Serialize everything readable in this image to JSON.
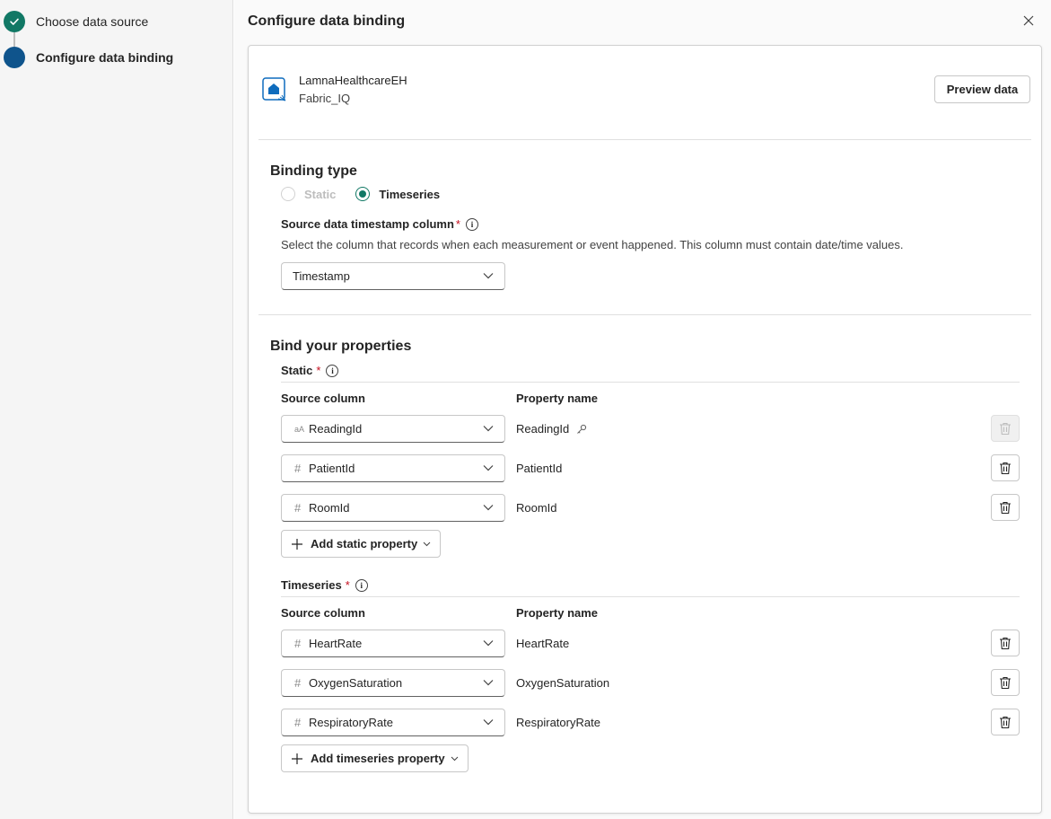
{
  "stepper": {
    "steps": [
      {
        "label": "Choose data source",
        "state": "done"
      },
      {
        "label": "Configure data binding",
        "state": "current"
      }
    ]
  },
  "panel": {
    "title": "Configure data binding",
    "close_icon": "close-icon"
  },
  "source": {
    "name": "LamnaHealthcareEH",
    "workspace": "Fabric_IQ",
    "preview_label": "Preview data"
  },
  "binding_type": {
    "title": "Binding type",
    "options": [
      {
        "label": "Static",
        "selected": false,
        "disabled": true
      },
      {
        "label": "Timeseries",
        "selected": true,
        "disabled": false
      }
    ],
    "timestamp_label": "Source data timestamp column",
    "timestamp_required": "*",
    "timestamp_hint": "Select the column that records when each measurement or event happened. This column must contain date/time values.",
    "timestamp_value": "Timestamp"
  },
  "bind_properties": {
    "title": "Bind your properties",
    "static": {
      "title": "Static",
      "required": "*",
      "source_header": "Source column",
      "property_header": "Property name",
      "rows": [
        {
          "type_icon": "aA",
          "source": "ReadingId",
          "property": "ReadingId",
          "is_key": true,
          "delete_disabled": true
        },
        {
          "type_icon": "#",
          "source": "PatientId",
          "property": "PatientId",
          "is_key": false,
          "delete_disabled": false
        },
        {
          "type_icon": "#",
          "source": "RoomId",
          "property": "RoomId",
          "is_key": false,
          "delete_disabled": false
        }
      ],
      "add_label": "Add static property"
    },
    "timeseries": {
      "title": "Timeseries",
      "required": "*",
      "source_header": "Source column",
      "property_header": "Property name",
      "rows": [
        {
          "type_icon": "#",
          "source": "HeartRate",
          "property": "HeartRate"
        },
        {
          "type_icon": "#",
          "source": "OxygenSaturation",
          "property": "OxygenSaturation"
        },
        {
          "type_icon": "#",
          "source": "RespiratoryRate",
          "property": "RespiratoryRate"
        }
      ],
      "add_label": "Add timeseries property"
    }
  },
  "colors": {
    "done": "#117865",
    "current": "#0f548c",
    "required": "#c50f1f",
    "radio_selected": "#117865"
  }
}
